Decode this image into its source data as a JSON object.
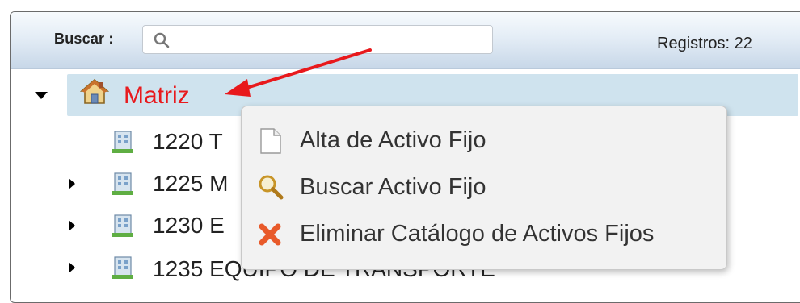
{
  "search": {
    "label": "Buscar :",
    "value": "",
    "placeholder": ""
  },
  "records": {
    "text": "Registros: 22"
  },
  "tree": {
    "root": {
      "label": "Matriz",
      "icon": "home-icon",
      "expanded": true
    },
    "children": [
      {
        "label": "1220 T",
        "icon": "building-icon",
        "has_children": false
      },
      {
        "label": "1225 M",
        "icon": "building-icon",
        "has_children": true
      },
      {
        "label": "1230 E",
        "icon": "building-icon",
        "has_children": true
      },
      {
        "label": "1235 EQUIPO DE TRANSPORTE",
        "icon": "building-icon",
        "has_children": true
      }
    ]
  },
  "context_menu": {
    "items": [
      {
        "label": "Alta de Activo Fijo",
        "icon": "document-icon"
      },
      {
        "label": "Buscar Activo Fijo",
        "icon": "magnifier-icon"
      },
      {
        "label": "Eliminar Catálogo de Activos Fijos",
        "icon": "delete-x-icon"
      }
    ]
  },
  "colors": {
    "highlight_row": "#cfe3ee",
    "matriz_text": "#e8191c",
    "annotation_arrow": "#e8191c"
  }
}
